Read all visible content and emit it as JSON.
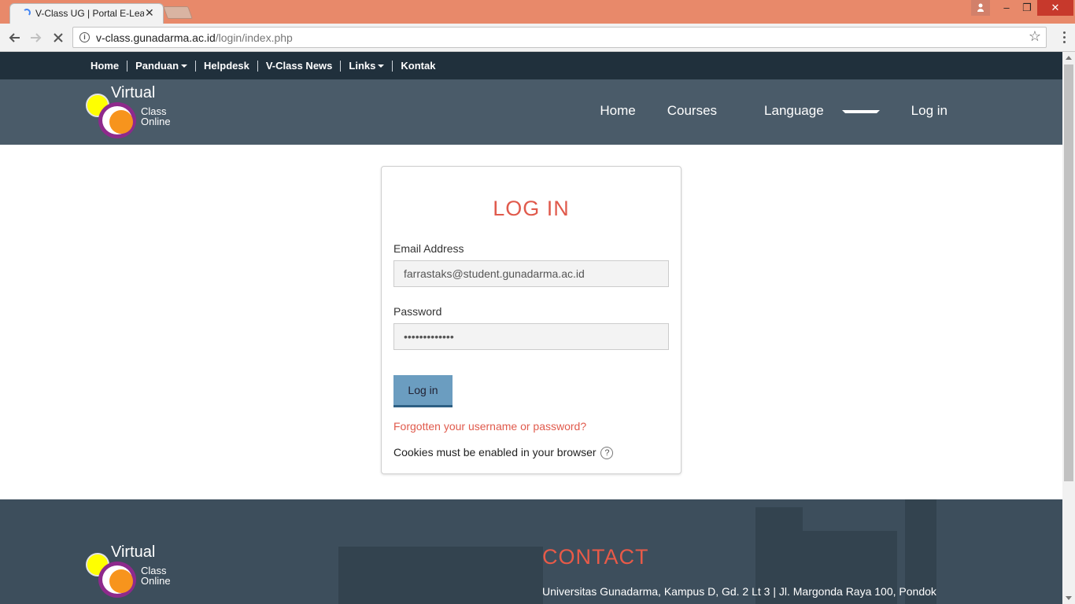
{
  "browser": {
    "tab_title": "V-Class UG | Portal E-Learning",
    "close_symbol": "✕",
    "url_domain": "v-class.gunadarma.ac.id",
    "url_path": "/login/index.php",
    "window_buttons": {
      "minimize": "–",
      "maximize": "❐",
      "close": "✕"
    }
  },
  "topbar": {
    "items": [
      {
        "label": "Home"
      },
      {
        "label": "Panduan"
      },
      {
        "label": "Helpdesk"
      },
      {
        "label": "V-Class News"
      },
      {
        "label": "Links"
      },
      {
        "label": "Kontak"
      }
    ]
  },
  "logo": {
    "line1": "Virtual",
    "line2": "Class",
    "line3": "Online"
  },
  "mainnav": {
    "home": "Home",
    "courses": "Courses",
    "language": "Language",
    "login": "Log in"
  },
  "login": {
    "title": "LOG IN",
    "email_label": "Email Address",
    "email_value": "farrastaks@student.gunadarma.ac.id",
    "password_label": "Password",
    "password_value": "•••••••••••••",
    "submit": "Log in",
    "forgot": "Forgotten your username or password?",
    "cookies": "Cookies must be enabled in your browser",
    "help": "?"
  },
  "footer": {
    "contact_title": "CONTACT",
    "address": "Universitas Gunadarma, Kampus D, Gd. 2 Lt 3 | Jl. Margonda Raya 100, Pondok"
  },
  "colors": {
    "accent": "#e05a4c",
    "header": "#4a5b69",
    "topbar": "#20303c",
    "button": "#6b9dc0"
  }
}
